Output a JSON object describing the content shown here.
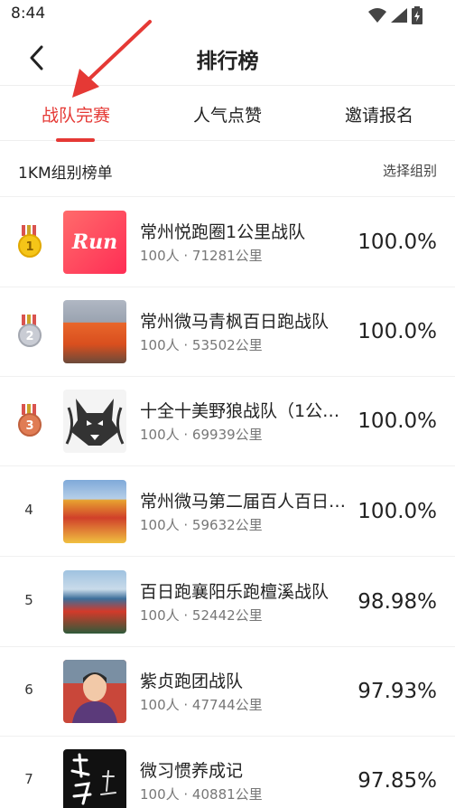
{
  "status_bar": {
    "time": "8:44",
    "icons": [
      "wifi-icon",
      "cell-signal-icon",
      "battery-charging-icon"
    ]
  },
  "nav": {
    "title": "排行榜",
    "back_icon": "chevron-left-icon"
  },
  "tabs": [
    {
      "label": "战队完赛",
      "active": true
    },
    {
      "label": "人气点赞",
      "active": false
    },
    {
      "label": "邀请报名",
      "active": false
    }
  ],
  "group": {
    "title": "1KM组别榜单",
    "select_label": "选择组别"
  },
  "colors": {
    "accent": "#e53935",
    "gold": "#f5c518",
    "silver": "#b8bcc6",
    "bronze": "#e07c54"
  },
  "rankings": [
    {
      "rank": "1",
      "name": "常州悦跑圈1公里战队",
      "sub": "100人 · 71281公里",
      "pct": "100.0%",
      "medal": "gold",
      "thumb": "run-logo"
    },
    {
      "rank": "2",
      "name": "常州微马青枫百日跑战队",
      "sub": "100人 · 53502公里",
      "pct": "100.0%",
      "medal": "silver",
      "thumb": "group-photo"
    },
    {
      "rank": "3",
      "name": "十全十美野狼战队（1公…",
      "sub": "100人 · 69939公里",
      "pct": "100.0%",
      "medal": "bronze",
      "thumb": "wolf-drawing"
    },
    {
      "rank": "4",
      "name": "常州微马第二届百人百日…",
      "sub": "100人 · 59632公里",
      "pct": "100.0%",
      "medal": "",
      "thumb": "group-photo"
    },
    {
      "rank": "5",
      "name": "百日跑襄阳乐跑檀溪战队",
      "sub": "100人 · 52442公里",
      "pct": "98.98%",
      "medal": "",
      "thumb": "group-photo"
    },
    {
      "rank": "6",
      "name": "紫贞跑团战队",
      "sub": "100人 · 47744公里",
      "pct": "97.93%",
      "medal": "",
      "thumb": "portrait-photo"
    },
    {
      "rank": "7",
      "name": "微习惯养成记",
      "sub": "100人 · 40881公里",
      "pct": "97.85%",
      "medal": "",
      "thumb": "calligraphy-logo"
    }
  ]
}
